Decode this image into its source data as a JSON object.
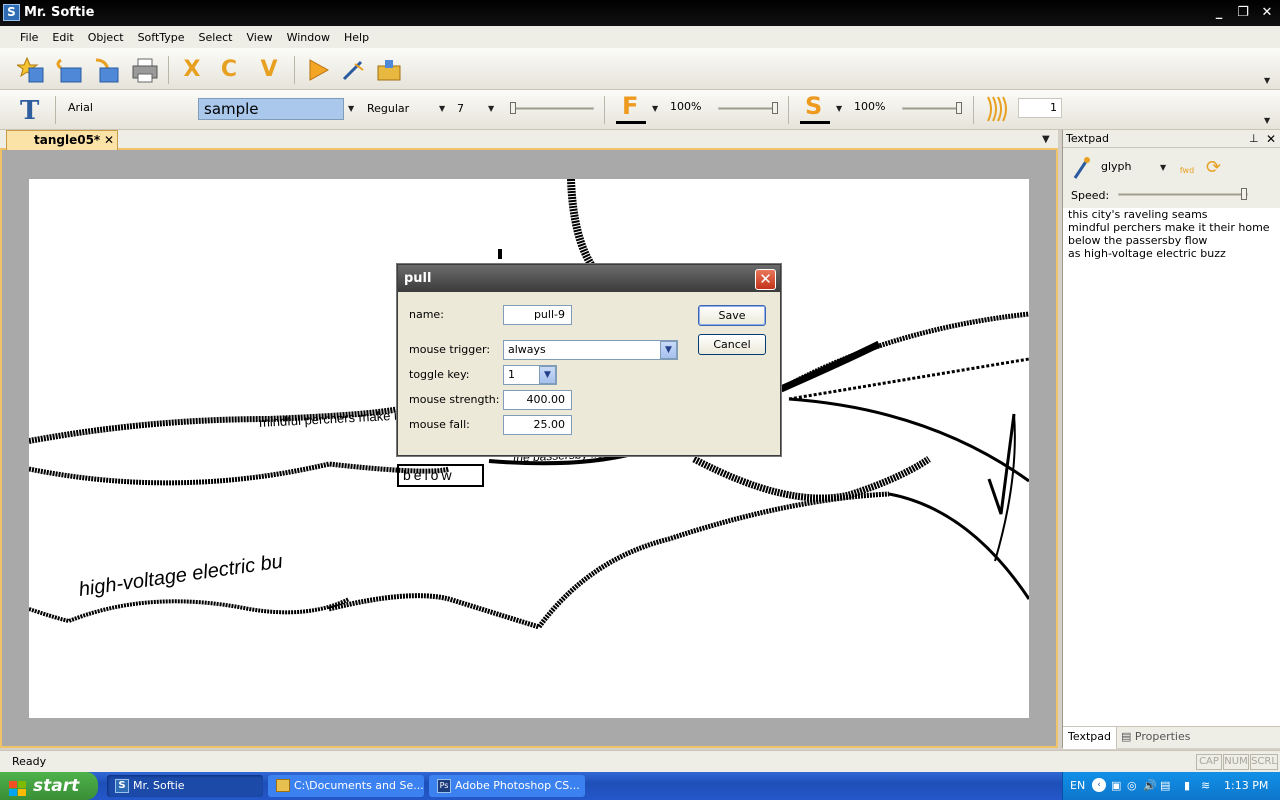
{
  "window": {
    "title": "Mr. Softie",
    "app_icon": "S"
  },
  "menu": [
    "File",
    "Edit",
    "Object",
    "SoftType",
    "Select",
    "View",
    "Window",
    "Help"
  ],
  "toolbar1": {
    "icons": [
      "new-star-icon",
      "open-icon",
      "import-icon",
      "print-icon",
      "x-tool-icon",
      "c-tool-icon",
      "v-tool-icon",
      "play-icon",
      "wand-icon",
      "folder-icon"
    ]
  },
  "toolbar2": {
    "text_tool": "T",
    "font_name": "Arial",
    "sample_text": "sample",
    "font_style": "Regular",
    "font_size": "7",
    "fill_label": "F",
    "fill_percent": "100%",
    "stroke_label": "S",
    "stroke_percent": "100%",
    "count_value": "1"
  },
  "document": {
    "tab_label": "tangle05*"
  },
  "canvas": {
    "text_paths": [
      "mindful perchers make it their home",
      "below",
      "the passersby flow",
      "high-voltage electric bu"
    ]
  },
  "dialog": {
    "title": "pull",
    "name_label": "name:",
    "name_value": "pull-9",
    "mouse_trigger_label": "mouse trigger:",
    "mouse_trigger_value": "always",
    "toggle_key_label": "toggle key:",
    "toggle_key_value": "1",
    "mouse_strength_label": "mouse strength:",
    "mouse_strength_value": "400.00",
    "mouse_fall_label": "mouse fall:",
    "mouse_fall_value": "25.00",
    "save_label": "Save",
    "cancel_label": "Cancel"
  },
  "textpad": {
    "title": "Textpad",
    "mode": "glyph",
    "fwd_label": "fwd",
    "speed_label": "Speed:",
    "lines": [
      "this city's raveling seams",
      "mindful perchers make it their home",
      "below the passersby flow",
      "as high-voltage electric buzz"
    ],
    "tabs": [
      "Textpad",
      "Properties"
    ]
  },
  "status": {
    "text": "Ready",
    "indicators": [
      "CAP",
      "NUM",
      "SCRL"
    ]
  },
  "taskbar": {
    "start_label": "start",
    "tasks": [
      "Mr. Softie",
      "C:\\Documents and Se...",
      "Adobe Photoshop CS..."
    ],
    "lang": "EN",
    "time": "1:13 PM"
  }
}
